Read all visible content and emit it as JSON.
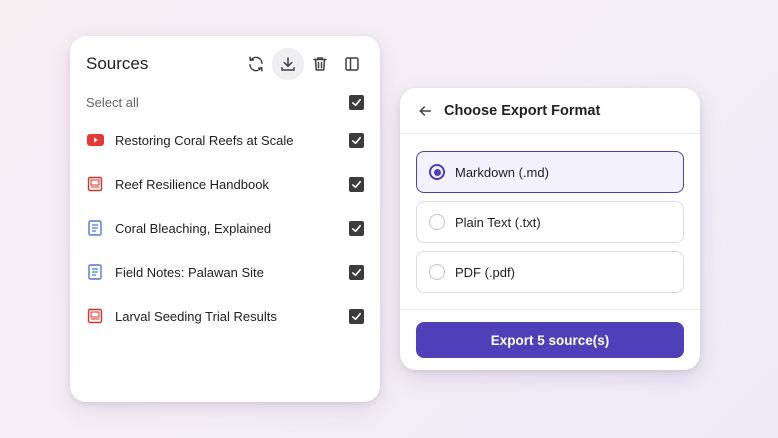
{
  "sources_panel": {
    "title": "Sources",
    "tools": [
      {
        "icon": "refresh-icon"
      },
      {
        "icon": "download-icon",
        "active": true
      },
      {
        "icon": "trash-icon"
      },
      {
        "icon": "sidebar-toggle-icon"
      }
    ],
    "select_all_label": "Select all",
    "select_all_checked": true,
    "items": [
      {
        "label": "Restoring Coral Reefs at Scale",
        "icon": "youtube-icon",
        "checked": true
      },
      {
        "label": "Reef Resilience Handbook",
        "icon": "pdf-icon",
        "checked": true
      },
      {
        "label": "Coral Bleaching, Explained",
        "icon": "document-icon",
        "checked": true
      },
      {
        "label": "Field Notes: Palawan Site",
        "icon": "document-icon",
        "checked": true
      },
      {
        "label": "Larval Seeding Trial Results",
        "icon": "pdf-icon",
        "checked": true
      }
    ]
  },
  "export_dialog": {
    "title": "Choose Export Format",
    "options": [
      {
        "label": "Markdown (.md)",
        "selected": true
      },
      {
        "label": "Plain Text (.txt)",
        "selected": false
      },
      {
        "label": "PDF (.pdf)",
        "selected": false
      }
    ],
    "export_button_label": "Export 5 source(s)"
  },
  "colors": {
    "accent": "#4f3fb8",
    "youtube_red": "#e53935",
    "pdf_red": "#d93025",
    "doc_blue": "#4a7bd4",
    "checkbox_dark": "#3c3c3c"
  }
}
